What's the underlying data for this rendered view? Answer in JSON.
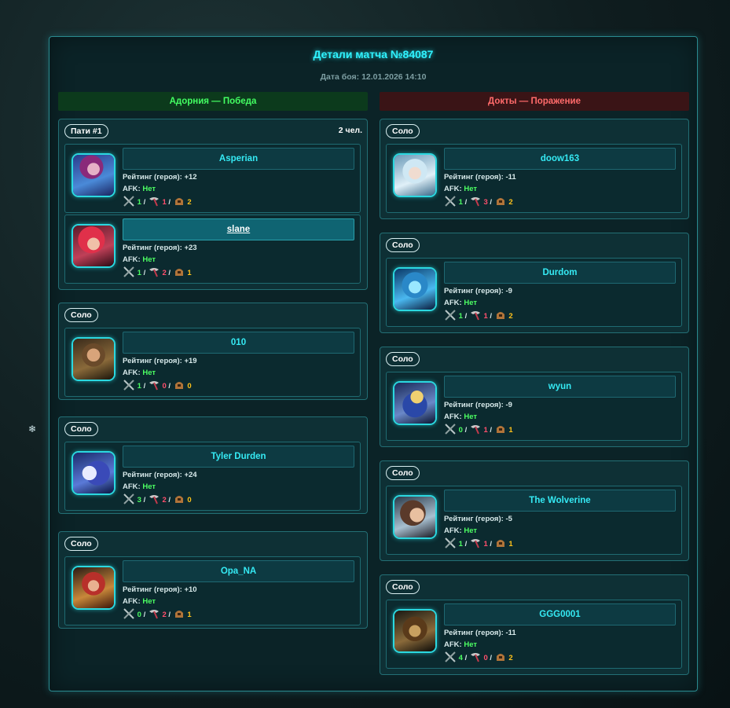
{
  "header": {
    "title": "Детали матча №84087",
    "date_label": "Дата боя: 12.01.2026 14:10"
  },
  "colors": {
    "accent": "#2ff3ff",
    "win": "#43ff62",
    "lose": "#ff6a6a",
    "kills": "#4cff63",
    "deaths": "#ff4f6c",
    "assists": "#ffc21a"
  },
  "icons": {
    "kills": "crossed-swords-icon",
    "deaths": "axe-icon",
    "assists": "helmet-icon",
    "snow": "snowflake-icon"
  },
  "winners": {
    "header": "Адорния — Победа",
    "groups": [
      {
        "badge": "Пати #1",
        "count": "2 чел.",
        "players": [
          {
            "name": "Asperian",
            "rating_label": "Рейтинг (героя):",
            "rating": "+12",
            "afk_label": "AFK:",
            "afk": "Нет",
            "kills": "1",
            "deaths": "1",
            "assists": "2"
          },
          {
            "name": "slane",
            "rating_label": "Рейтинг (героя):",
            "rating": "+23",
            "afk_label": "AFK:",
            "afk": "Нет",
            "kills": "1",
            "deaths": "2",
            "assists": "1"
          }
        ]
      },
      {
        "badge": "Соло",
        "players": [
          {
            "name": "010",
            "rating_label": "Рейтинг (героя):",
            "rating": "+19",
            "afk_label": "AFK:",
            "afk": "Нет",
            "kills": "1",
            "deaths": "0",
            "assists": "0"
          }
        ]
      },
      {
        "badge": "Соло",
        "players": [
          {
            "name": "Tyler Durden",
            "rating_label": "Рейтинг (героя):",
            "rating": "+24",
            "afk_label": "AFK:",
            "afk": "Нет",
            "kills": "3",
            "deaths": "2",
            "assists": "0"
          }
        ]
      },
      {
        "badge": "Соло",
        "players": [
          {
            "name": "Opa_NA",
            "rating_label": "Рейтинг (героя):",
            "rating": "+10",
            "afk_label": "AFK:",
            "afk": "Нет",
            "kills": "0",
            "deaths": "2",
            "assists": "1"
          }
        ]
      }
    ]
  },
  "losers": {
    "header": "Докты — Поражение",
    "groups": [
      {
        "badge": "Соло",
        "players": [
          {
            "name": "doow163",
            "rating_label": "Рейтинг (героя):",
            "rating": "-11",
            "afk_label": "AFK:",
            "afk": "Нет",
            "kills": "1",
            "deaths": "3",
            "assists": "2"
          }
        ]
      },
      {
        "badge": "Соло",
        "players": [
          {
            "name": "Durdom",
            "rating_label": "Рейтинг (героя):",
            "rating": "-9",
            "afk_label": "AFK:",
            "afk": "Нет",
            "kills": "1",
            "deaths": "1",
            "assists": "2"
          }
        ]
      },
      {
        "badge": "Соло",
        "players": [
          {
            "name": "wyun",
            "rating_label": "Рейтинг (героя):",
            "rating": "-9",
            "afk_label": "AFK:",
            "afk": "Нет",
            "kills": "0",
            "deaths": "1",
            "assists": "1"
          }
        ]
      },
      {
        "badge": "Соло",
        "players": [
          {
            "name": "The Wolverine",
            "rating_label": "Рейтинг (героя):",
            "rating": "-5",
            "afk_label": "AFK:",
            "afk": "Нет",
            "kills": "1",
            "deaths": "1",
            "assists": "1"
          }
        ]
      },
      {
        "badge": "Соло",
        "players": [
          {
            "name": "GGG0001",
            "rating_label": "Рейтинг (героя):",
            "rating": "-11",
            "afk_label": "AFK:",
            "afk": "Нет",
            "kills": "4",
            "deaths": "0",
            "assists": "2"
          }
        ]
      }
    ]
  }
}
